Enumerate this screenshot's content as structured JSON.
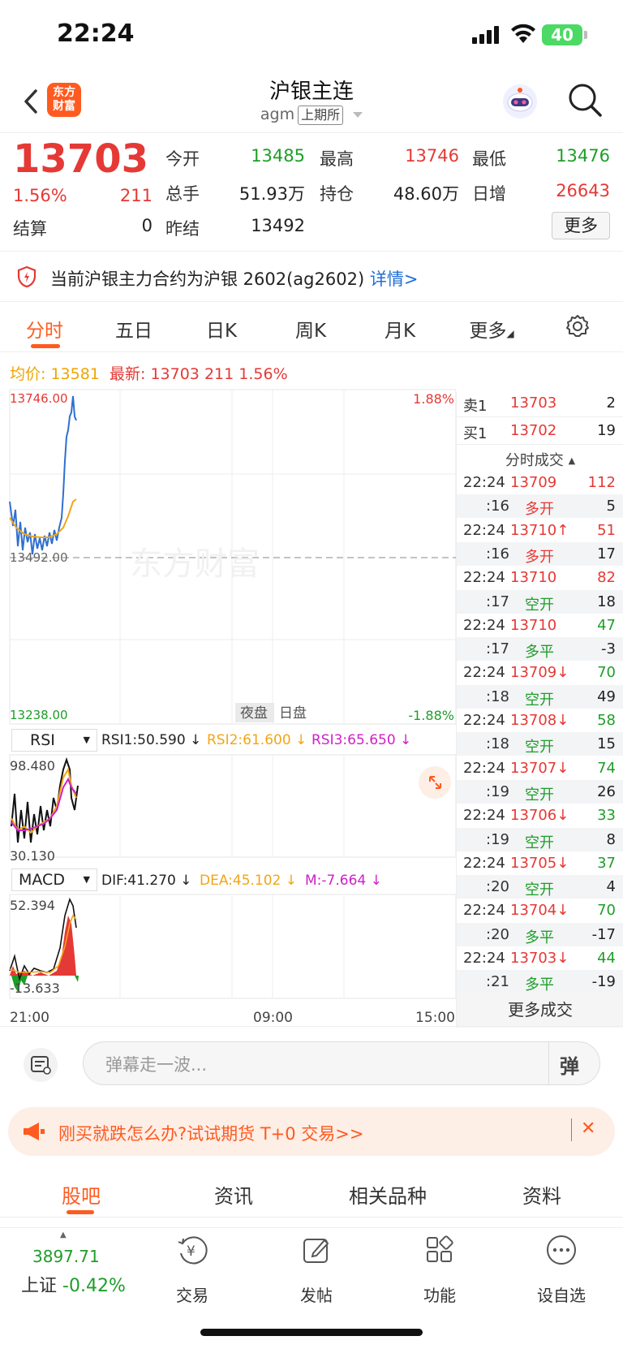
{
  "status": {
    "time": "22:24",
    "battery": "40"
  },
  "nav": {
    "logo_text": "东方\n财富",
    "title": "沪银主连",
    "code": "agm",
    "exchange": "上期所"
  },
  "quote": {
    "price": "13703",
    "change_pct": "1.56%",
    "change": "211",
    "open_label": "今开",
    "open": "13485",
    "high_label": "最高",
    "high": "13746",
    "low_label": "最低",
    "low": "13476",
    "volume_label": "总手",
    "volume": "51.93万",
    "oi_label": "持仓",
    "oi": "48.60万",
    "daily_inc_label": "日增",
    "daily_inc": "26643",
    "settle_label": "结算",
    "settle": "0",
    "prev_settle_label": "昨结",
    "prev_settle": "13492",
    "more": "更多"
  },
  "notice": {
    "text": "当前沪银主力合约为沪银 2602(ag2602)",
    "link": "详情>"
  },
  "tabs": [
    "分时",
    "五日",
    "日K",
    "周K",
    "月K",
    "更多"
  ],
  "avg": {
    "avg_label": "均价:",
    "avg": "13581",
    "latest_label": "最新:",
    "latest": "13703",
    "chg": "211",
    "pct": "1.56%"
  },
  "chart": {
    "y_max": "13746.00",
    "y_mid": "13492.00",
    "y_min": "13238.00",
    "pct_max": "1.88%",
    "pct_min": "-1.88%",
    "watermark": "东方财富",
    "session_night": "夜盘",
    "session_day": "日盘",
    "rsi_label": "RSI",
    "rsi1": "RSI1:50.590 ↓",
    "rsi2": "RSI2:61.600 ↓",
    "rsi3": "RSI3:65.650 ↓",
    "rsi_max": "98.480",
    "rsi_min": "30.130",
    "macd_label": "MACD",
    "dif": "DIF:41.270 ↓",
    "dea": "DEA:45.102 ↓",
    "m": "M:-7.664 ↓",
    "macd_max": "52.394",
    "macd_min": "-13.633",
    "x_start": "21:00",
    "x_mid": "09:00",
    "x_end": "15:00"
  },
  "orderbook": {
    "sell_label": "卖1",
    "sell_price": "13703",
    "sell_vol": "2",
    "buy_label": "买1",
    "buy_price": "13702",
    "buy_vol": "19",
    "header": "分时成交",
    "trades": [
      {
        "t": "22:24",
        "p": "13709",
        "v": "112",
        "pc": "red",
        "vc": "red"
      },
      {
        "t": ":16",
        "p": "多开",
        "v": "5",
        "pc": "red",
        "vc": "dark"
      },
      {
        "t": "22:24",
        "p": "13710↑",
        "v": "51",
        "pc": "red",
        "vc": "red"
      },
      {
        "t": ":16",
        "p": "多开",
        "v": "17",
        "pc": "red",
        "vc": "dark"
      },
      {
        "t": "22:24",
        "p": "13710",
        "v": "82",
        "pc": "red",
        "vc": "red"
      },
      {
        "t": ":17",
        "p": "空开",
        "v": "18",
        "pc": "green",
        "vc": "dark"
      },
      {
        "t": "22:24",
        "p": "13710",
        "v": "47",
        "pc": "red",
        "vc": "green"
      },
      {
        "t": ":17",
        "p": "多平",
        "v": "-3",
        "pc": "green",
        "vc": "dark"
      },
      {
        "t": "22:24",
        "p": "13709↓",
        "v": "70",
        "pc": "red",
        "vc": "green"
      },
      {
        "t": ":18",
        "p": "空开",
        "v": "49",
        "pc": "green",
        "vc": "dark"
      },
      {
        "t": "22:24",
        "p": "13708↓",
        "v": "58",
        "pc": "red",
        "vc": "green"
      },
      {
        "t": ":18",
        "p": "空开",
        "v": "15",
        "pc": "green",
        "vc": "dark"
      },
      {
        "t": "22:24",
        "p": "13707↓",
        "v": "74",
        "pc": "red",
        "vc": "green"
      },
      {
        "t": ":19",
        "p": "空开",
        "v": "26",
        "pc": "green",
        "vc": "dark"
      },
      {
        "t": "22:24",
        "p": "13706↓",
        "v": "33",
        "pc": "red",
        "vc": "green"
      },
      {
        "t": ":19",
        "p": "空开",
        "v": "8",
        "pc": "green",
        "vc": "dark"
      },
      {
        "t": "22:24",
        "p": "13705↓",
        "v": "37",
        "pc": "red",
        "vc": "green"
      },
      {
        "t": ":20",
        "p": "空开",
        "v": "4",
        "pc": "green",
        "vc": "dark"
      },
      {
        "t": "22:24",
        "p": "13704↓",
        "v": "70",
        "pc": "red",
        "vc": "green"
      },
      {
        "t": ":20",
        "p": "多平",
        "v": "-17",
        "pc": "green",
        "vc": "dark"
      },
      {
        "t": "22:24",
        "p": "13703↓",
        "v": "44",
        "pc": "red",
        "vc": "green"
      },
      {
        "t": ":21",
        "p": "多平",
        "v": "-19",
        "pc": "green",
        "vc": "dark"
      }
    ],
    "more": "更多成交"
  },
  "comment": {
    "placeholder": "弹幕走一波...",
    "danmu": "弹"
  },
  "ad": {
    "text": "刚买就跌怎么办?试试期货 T+0 交易>>",
    "close": "✕"
  },
  "bottom_tabs": [
    "股吧",
    "资讯",
    "相关品种",
    "资料"
  ],
  "index": {
    "value": "3897.71",
    "name": "上证",
    "pct": "-0.42%"
  },
  "toolbar": [
    "交易",
    "发帖",
    "功能",
    "设自选"
  ],
  "colors": {
    "red": "#e53935",
    "green": "#1e9e28",
    "orange": "#ff5a1f",
    "blue": "#1e6fd9"
  }
}
